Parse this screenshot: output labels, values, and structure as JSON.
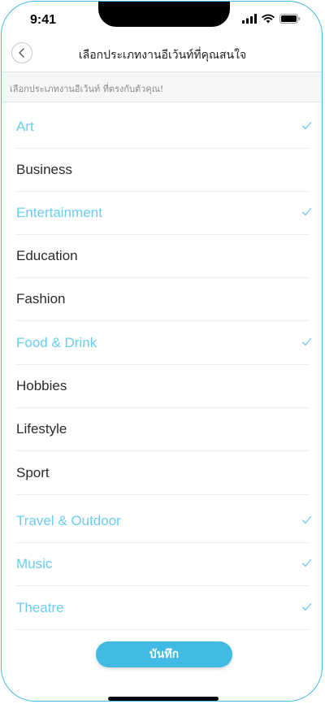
{
  "status_bar": {
    "time": "9:41"
  },
  "nav": {
    "title": "เลือกประเภทงานอีเว้นท์ที่คุณสนใจ"
  },
  "subtitle": "เลือกประเภทงานอีเว้นท์ ที่ตรงกับตัวคุณ!",
  "categories": [
    {
      "label": "Art",
      "selected": true
    },
    {
      "label": "Business",
      "selected": false
    },
    {
      "label": "Entertainment",
      "selected": true
    },
    {
      "label": "Education",
      "selected": false
    },
    {
      "label": "Fashion",
      "selected": false
    },
    {
      "label": "Food & Drink",
      "selected": true
    },
    {
      "label": "Hobbies",
      "selected": false
    },
    {
      "label": "Lifestyle",
      "selected": false
    },
    {
      "label": "Sport",
      "selected": false
    },
    {
      "label": "Travel & Outdoor",
      "selected": true
    },
    {
      "label": "Music",
      "selected": true
    },
    {
      "label": "Theatre",
      "selected": true
    }
  ],
  "save_button": {
    "label": "บันทึก"
  },
  "colors": {
    "accent": "#41bbe4",
    "selected_text": "#6bcdf0",
    "unselected_text": "#2b2b2b"
  },
  "icons": {
    "back": "chevron-left-icon",
    "check": "checkmark-icon",
    "signal": "signal-icon",
    "wifi": "wifi-icon",
    "battery": "battery-icon"
  }
}
